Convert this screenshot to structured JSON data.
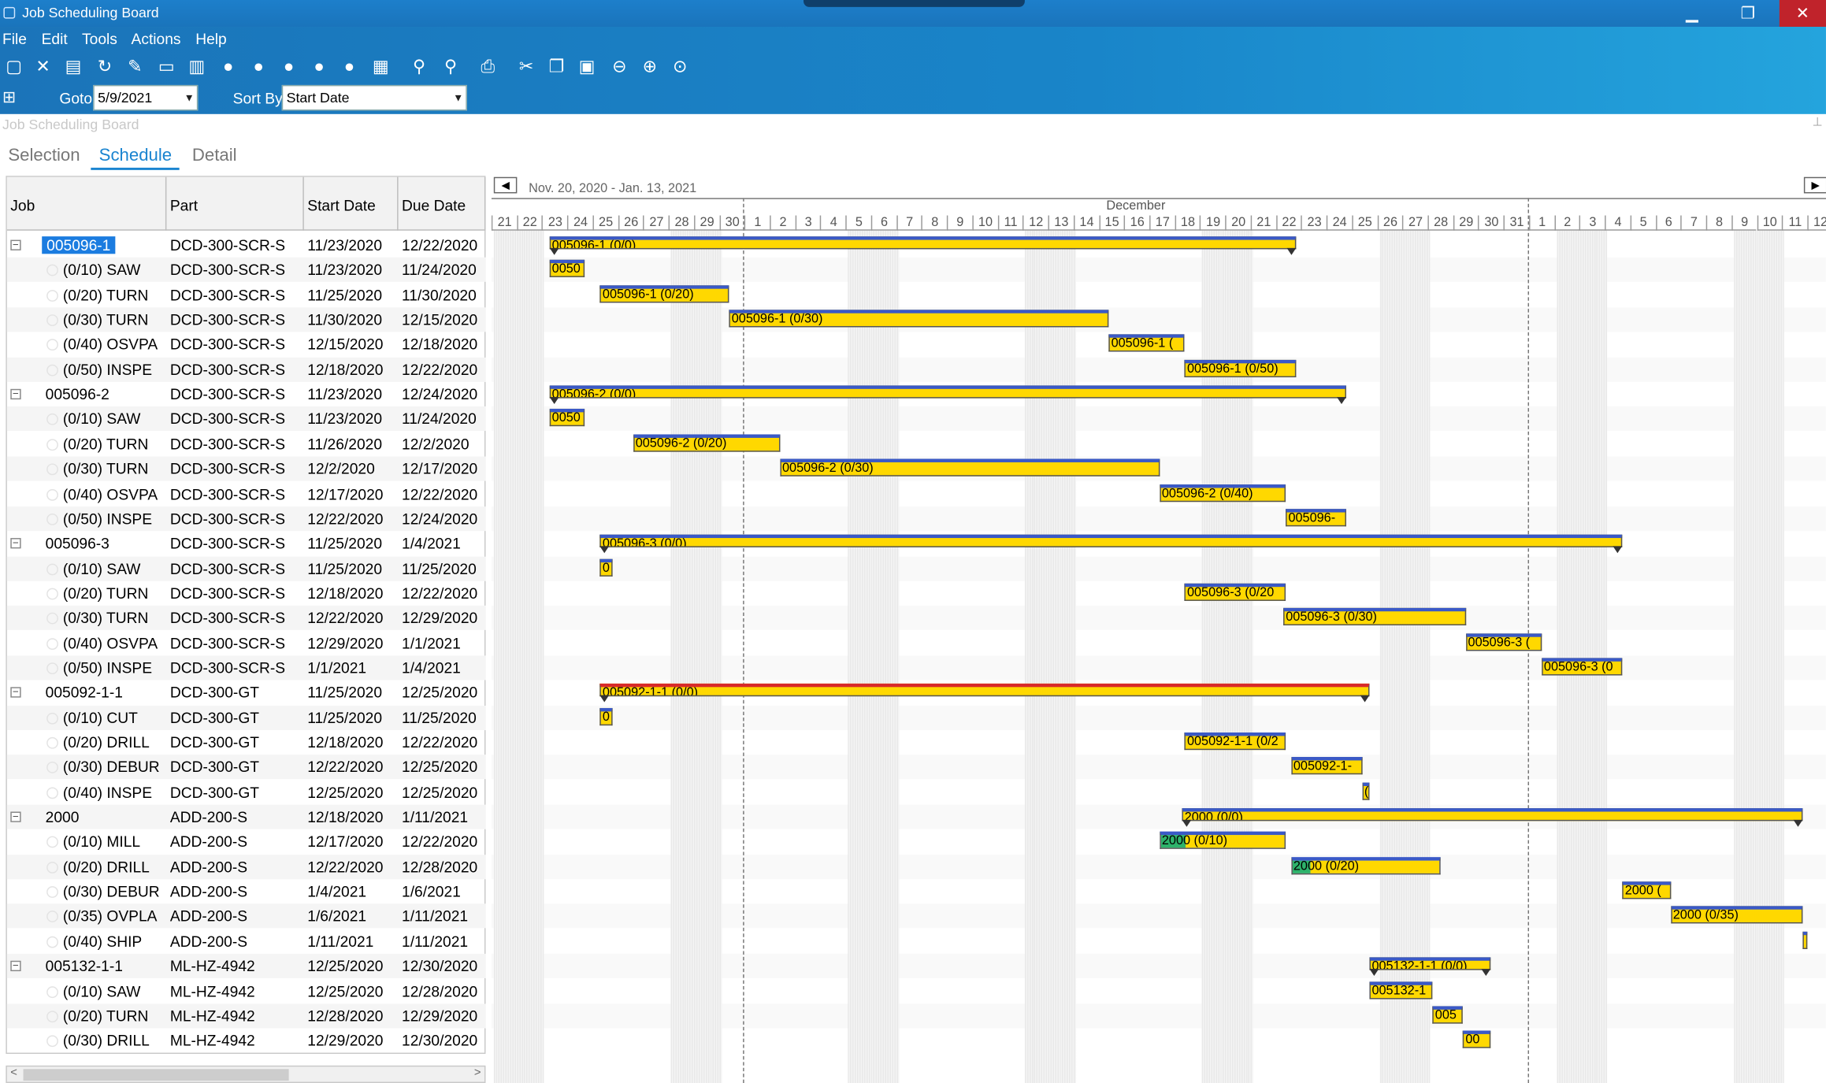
{
  "window": {
    "title": "Job Scheduling Board",
    "minimize": "▁",
    "restore": "❐",
    "close": "✕"
  },
  "menu": [
    "File",
    "Edit",
    "Tools",
    "Actions",
    "Help"
  ],
  "toolbar": {
    "goto_label": "Goto",
    "goto_value": "5/9/2021",
    "sortby_label": "Sort By",
    "sortby_value": "Start Date"
  },
  "panel_caption": "Job Scheduling Board",
  "tabs": [
    "Selection",
    "Schedule",
    "Detail"
  ],
  "grid": {
    "headers": [
      "Job",
      "Part",
      "Start Date",
      "Due Date"
    ],
    "rows": [
      {
        "job": "005096-1",
        "part": "DCD-300-SCR-S",
        "start": "11/23/2020",
        "due": "12/22/2020",
        "parent": true,
        "selected": true
      },
      {
        "job": "(0/10) SAW",
        "part": "DCD-300-SCR-S",
        "start": "11/23/2020",
        "due": "11/24/2020"
      },
      {
        "job": "(0/20) TURN",
        "part": "DCD-300-SCR-S",
        "start": "11/25/2020",
        "due": "11/30/2020"
      },
      {
        "job": "(0/30) TURN",
        "part": "DCD-300-SCR-S",
        "start": "11/30/2020",
        "due": "12/15/2020"
      },
      {
        "job": "(0/40) OSVPA",
        "part": "DCD-300-SCR-S",
        "start": "12/15/2020",
        "due": "12/18/2020"
      },
      {
        "job": "(0/50) INSPE",
        "part": "DCD-300-SCR-S",
        "start": "12/18/2020",
        "due": "12/22/2020"
      },
      {
        "job": "005096-2",
        "part": "DCD-300-SCR-S",
        "start": "11/23/2020",
        "due": "12/24/2020",
        "parent": true
      },
      {
        "job": "(0/10) SAW",
        "part": "DCD-300-SCR-S",
        "start": "11/23/2020",
        "due": "11/24/2020"
      },
      {
        "job": "(0/20) TURN",
        "part": "DCD-300-SCR-S",
        "start": "11/26/2020",
        "due": "12/2/2020"
      },
      {
        "job": "(0/30) TURN",
        "part": "DCD-300-SCR-S",
        "start": "12/2/2020",
        "due": "12/17/2020"
      },
      {
        "job": "(0/40) OSVPA",
        "part": "DCD-300-SCR-S",
        "start": "12/17/2020",
        "due": "12/22/2020"
      },
      {
        "job": "(0/50) INSPE",
        "part": "DCD-300-SCR-S",
        "start": "12/22/2020",
        "due": "12/24/2020"
      },
      {
        "job": "005096-3",
        "part": "DCD-300-SCR-S",
        "start": "11/25/2020",
        "due": "1/4/2021",
        "parent": true
      },
      {
        "job": "(0/10) SAW",
        "part": "DCD-300-SCR-S",
        "start": "11/25/2020",
        "due": "11/25/2020"
      },
      {
        "job": "(0/20) TURN",
        "part": "DCD-300-SCR-S",
        "start": "12/18/2020",
        "due": "12/22/2020"
      },
      {
        "job": "(0/30) TURN",
        "part": "DCD-300-SCR-S",
        "start": "12/22/2020",
        "due": "12/29/2020"
      },
      {
        "job": "(0/40) OSVPA",
        "part": "DCD-300-SCR-S",
        "start": "12/29/2020",
        "due": "1/1/2021"
      },
      {
        "job": "(0/50) INSPE",
        "part": "DCD-300-SCR-S",
        "start": "1/1/2021",
        "due": "1/4/2021"
      },
      {
        "job": "005092-1-1",
        "part": "DCD-300-GT",
        "start": "11/25/2020",
        "due": "12/25/2020",
        "parent": true
      },
      {
        "job": "(0/10) CUT",
        "part": "DCD-300-GT",
        "start": "11/25/2020",
        "due": "11/25/2020"
      },
      {
        "job": "(0/20) DRILL",
        "part": "DCD-300-GT",
        "start": "12/18/2020",
        "due": "12/22/2020"
      },
      {
        "job": "(0/30) DEBUR",
        "part": "DCD-300-GT",
        "start": "12/22/2020",
        "due": "12/25/2020"
      },
      {
        "job": "(0/40) INSPE",
        "part": "DCD-300-GT",
        "start": "12/25/2020",
        "due": "12/25/2020"
      },
      {
        "job": "2000",
        "part": "ADD-200-S",
        "start": "12/18/2020",
        "due": "1/11/2021",
        "parent": true
      },
      {
        "job": "(0/10) MILL",
        "part": "ADD-200-S",
        "start": "12/17/2020",
        "due": "12/22/2020"
      },
      {
        "job": "(0/20) DRILL",
        "part": "ADD-200-S",
        "start": "12/22/2020",
        "due": "12/28/2020"
      },
      {
        "job": "(0/30) DEBUR",
        "part": "ADD-200-S",
        "start": "1/4/2021",
        "due": "1/6/2021"
      },
      {
        "job": "(0/35) OVPLA",
        "part": "ADD-200-S",
        "start": "1/6/2021",
        "due": "1/11/2021"
      },
      {
        "job": "(0/40) SHIP",
        "part": "ADD-200-S",
        "start": "1/11/2021",
        "due": "1/11/2021"
      },
      {
        "job": "005132-1-1",
        "part": "ML-HZ-4942",
        "start": "12/25/2020",
        "due": "12/30/2020",
        "parent": true
      },
      {
        "job": "(0/10) SAW",
        "part": "ML-HZ-4942",
        "start": "12/25/2020",
        "due": "12/28/2020"
      },
      {
        "job": "(0/20) TURN",
        "part": "ML-HZ-4942",
        "start": "12/28/2020",
        "due": "12/29/2020"
      },
      {
        "job": "(0/30) DRILL",
        "part": "ML-HZ-4942",
        "start": "12/29/2020",
        "due": "12/30/2020"
      }
    ]
  },
  "gantt": {
    "range": "Nov. 20, 2020 - Jan. 13, 2021",
    "month": "December",
    "days": [
      21,
      22,
      23,
      24,
      25,
      26,
      27,
      28,
      29,
      30,
      1,
      2,
      3,
      4,
      5,
      6,
      7,
      8,
      9,
      10,
      11,
      12,
      13,
      14,
      15,
      16,
      17,
      18,
      19,
      20,
      21,
      22,
      23,
      24,
      25,
      26,
      27,
      28,
      29,
      30,
      31,
      1,
      2,
      3,
      4,
      5,
      6,
      7,
      8,
      9,
      10,
      11,
      12
    ],
    "weekend_starts": [
      0,
      7,
      14,
      21,
      28,
      35,
      42,
      49
    ],
    "bars": [
      {
        "row": 0,
        "start": 2.3,
        "end": 31.8,
        "label": "005096-1 (0/0)",
        "sum": true
      },
      {
        "row": 1,
        "start": 2.3,
        "end": 3.7,
        "label": "0050"
      },
      {
        "row": 2,
        "start": 4.3,
        "end": 9.4,
        "label": "005096-1 (0/20)"
      },
      {
        "row": 3,
        "start": 9.4,
        "end": 24.4,
        "label": "005096-1 (0/30)"
      },
      {
        "row": 4,
        "start": 24.4,
        "end": 27.4,
        "label": "005096-1 ("
      },
      {
        "row": 5,
        "start": 27.4,
        "end": 31.8,
        "label": "005096-1 (0/50)"
      },
      {
        "row": 6,
        "start": 2.3,
        "end": 33.8,
        "label": "005096-2 (0/0)",
        "sum": true
      },
      {
        "row": 7,
        "start": 2.3,
        "end": 3.7,
        "label": "0050"
      },
      {
        "row": 8,
        "start": 5.6,
        "end": 11.4,
        "label": "005096-2 (0/20)"
      },
      {
        "row": 9,
        "start": 11.4,
        "end": 26.4,
        "label": "005096-2 (0/30)"
      },
      {
        "row": 10,
        "start": 26.4,
        "end": 31.4,
        "label": "005096-2 (0/40)"
      },
      {
        "row": 11,
        "start": 31.4,
        "end": 33.8,
        "label": "005096-"
      },
      {
        "row": 12,
        "start": 4.3,
        "end": 44.7,
        "label": "005096-3 (0/0)",
        "sum": true
      },
      {
        "row": 13,
        "start": 4.3,
        "end": 4.8,
        "label": "0"
      },
      {
        "row": 14,
        "start": 27.4,
        "end": 31.4,
        "label": "005096-3 (0/20"
      },
      {
        "row": 15,
        "start": 31.3,
        "end": 38.5,
        "label": "005096-3 (0/30)"
      },
      {
        "row": 16,
        "start": 38.5,
        "end": 41.5,
        "label": "005096-3 ("
      },
      {
        "row": 17,
        "start": 41.5,
        "end": 44.7,
        "label": "005096-3 (0"
      },
      {
        "row": 18,
        "start": 4.3,
        "end": 34.7,
        "label": "005092-1-1 (0/0)",
        "sum": true,
        "red": true
      },
      {
        "row": 19,
        "start": 4.3,
        "end": 4.8,
        "label": "0"
      },
      {
        "row": 20,
        "start": 27.4,
        "end": 31.4,
        "label": "005092-1-1 (0/2"
      },
      {
        "row": 21,
        "start": 31.6,
        "end": 34.4,
        "label": "005092-1-"
      },
      {
        "row": 22,
        "start": 34.4,
        "end": 34.7,
        "label": "("
      },
      {
        "row": 23,
        "start": 27.3,
        "end": 51.8,
        "label": "2000 (0/0)",
        "sum": true
      },
      {
        "row": 24,
        "start": 26.4,
        "end": 31.4,
        "label": "2000 (0/10)",
        "progress": 20
      },
      {
        "row": 25,
        "start": 31.6,
        "end": 37.5,
        "label": "2000 (0/20)",
        "progress": 12
      },
      {
        "row": 26,
        "start": 44.7,
        "end": 46.6,
        "label": "2000 ("
      },
      {
        "row": 27,
        "start": 46.6,
        "end": 51.8,
        "label": "2000 (0/35)"
      },
      {
        "row": 28,
        "start": 51.8,
        "end": 52.0,
        "label": ""
      },
      {
        "row": 29,
        "start": 34.7,
        "end": 39.5,
        "label": "005132-1-1 (0/0)",
        "sum": true
      },
      {
        "row": 30,
        "start": 34.7,
        "end": 37.2,
        "label": "005132-1"
      },
      {
        "row": 31,
        "start": 37.2,
        "end": 38.4,
        "label": "005"
      },
      {
        "row": 32,
        "start": 38.4,
        "end": 39.5,
        "label": "00"
      }
    ]
  },
  "icons": [
    "new-icon",
    "delete-icon",
    "clear-icon",
    "refresh-icon",
    "tools-icon",
    "open-icon",
    "clipboard-icon",
    "resource-icon",
    "resource-check-icon",
    "resource-x-icon",
    "resource-down-icon",
    "resource-group-icon",
    "calendar-icon",
    "zoom-in-icon",
    "zoom-out-icon",
    "print-icon",
    "cut-icon",
    "copy-icon",
    "paste-icon",
    "back-icon",
    "forward-icon",
    "home-icon"
  ]
}
